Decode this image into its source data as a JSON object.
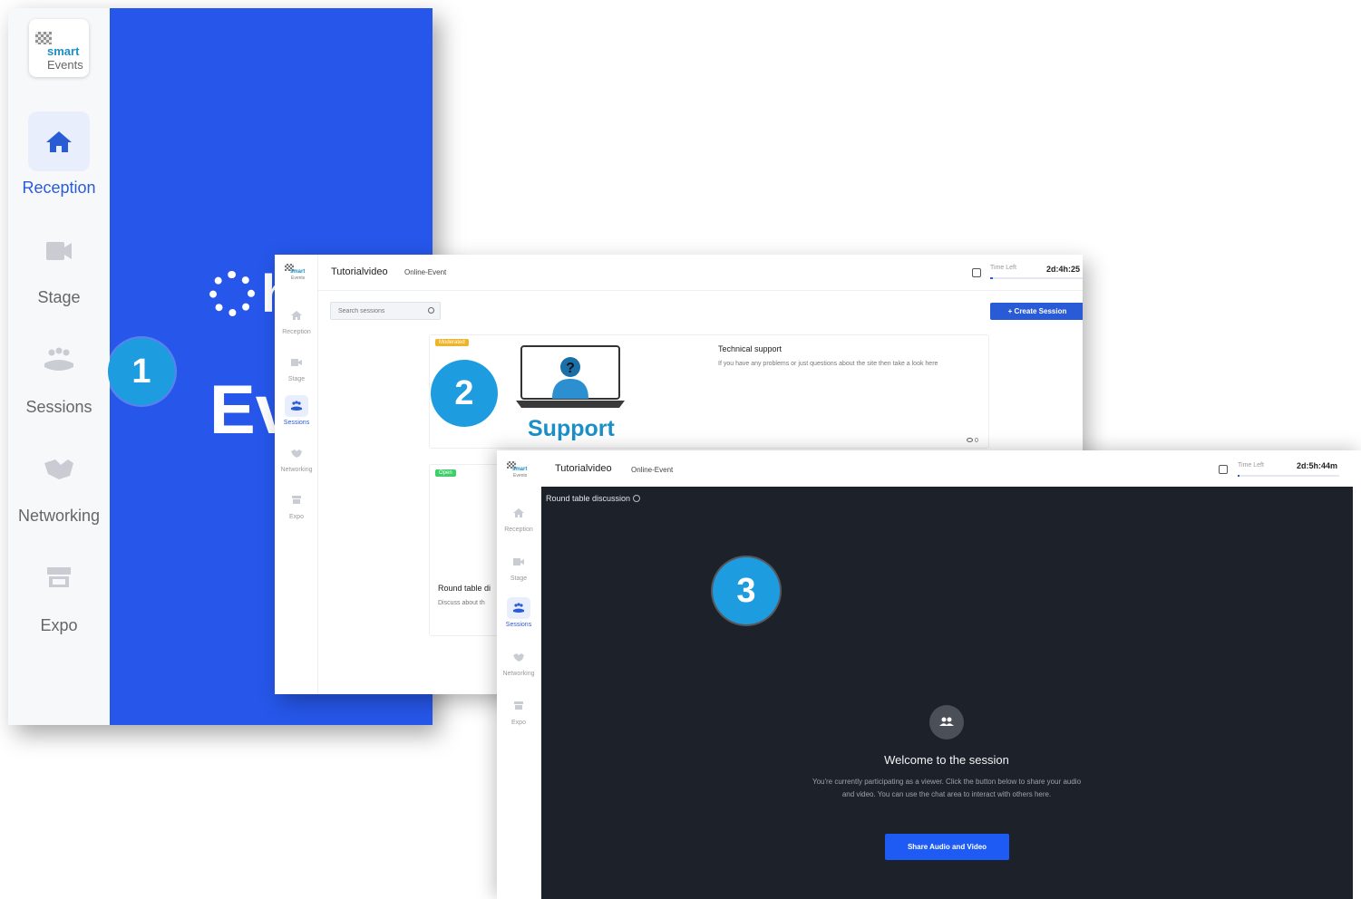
{
  "logo": {
    "line1": "smart",
    "line2": "Events"
  },
  "panel1": {
    "nav": [
      {
        "label": "Reception",
        "icon": "home-icon",
        "active": true
      },
      {
        "label": "Stage",
        "icon": "video-camera-icon",
        "active": false
      },
      {
        "label": "Sessions",
        "icon": "group-icon",
        "active": false
      },
      {
        "label": "Networking",
        "icon": "handshake-icon",
        "active": false
      },
      {
        "label": "Expo",
        "icon": "booth-icon",
        "active": false
      }
    ],
    "banner_fragment_1": "h",
    "banner_fragment_2": "Ev",
    "accent": "#2657ea"
  },
  "panel2": {
    "app_title": "Tutorialvideo",
    "event_type": "Online-Event",
    "time_left_label": "Time Left",
    "time_left_value": "2d:4h:25",
    "time_left_progress": 0.03,
    "nav": [
      {
        "label": "Reception",
        "active": false
      },
      {
        "label": "Stage",
        "active": false
      },
      {
        "label": "Sessions",
        "active": true
      },
      {
        "label": "Networking",
        "active": false
      },
      {
        "label": "Expo",
        "active": false
      }
    ],
    "search_placeholder": "Search sessions",
    "create_button": "+ Create Session",
    "cards": [
      {
        "badge": "Moderated",
        "badge_color": "#f0b429",
        "image_caption": "Support",
        "title": "Technical support",
        "description": "If you have any problems or just questions about the site then take a look here",
        "viewers": "0"
      },
      {
        "badge": "Open",
        "badge_color": "#3ecf6b",
        "title": "Round table di",
        "description": "Discuss about th"
      }
    ]
  },
  "panel3": {
    "app_title": "Tutorialvideo",
    "event_type": "Online-Event",
    "time_left_label": "Time Left",
    "time_left_value": "2d:5h:44m",
    "time_left_progress": 0.02,
    "nav": [
      {
        "label": "Reception",
        "active": false
      },
      {
        "label": "Stage",
        "active": false
      },
      {
        "label": "Sessions",
        "active": true
      },
      {
        "label": "Networking",
        "active": false
      },
      {
        "label": "Expo",
        "active": false
      }
    ],
    "session_title": "Round table discussion",
    "welcome_title": "Welcome to the session",
    "welcome_text": "You're currently participating as a viewer. Click the button below to share your audio and video. You can use the chat area to interact with others here.",
    "share_button": "Share Audio and Video"
  },
  "markers": [
    "1",
    "2",
    "3"
  ]
}
